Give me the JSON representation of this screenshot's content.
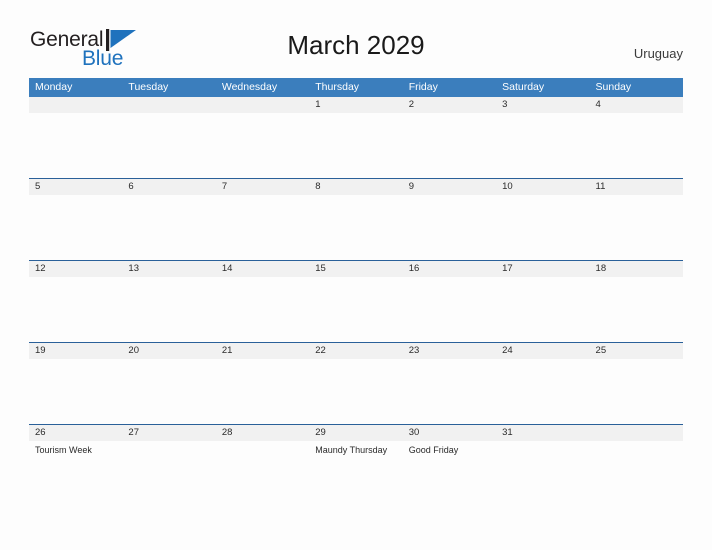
{
  "brand": {
    "name_part1": "General",
    "name_part2": "Blue",
    "logo_icon": "blue-flag-triangle-icon",
    "color_dark": "#231f20",
    "color_blue": "#1f72bd"
  },
  "header": {
    "title": "March 2029",
    "country": "Uruguay"
  },
  "theme": {
    "header_blue": "#3b7ebd",
    "separator_blue": "#2a6099",
    "date_band_gray": "#f1f1f1",
    "page_background": "#fdfdfd",
    "text_color": "#2b2b2b"
  },
  "calendar": {
    "weekdays": [
      "Monday",
      "Tuesday",
      "Wednesday",
      "Thursday",
      "Friday",
      "Saturday",
      "Sunday"
    ],
    "weeks": [
      {
        "days": [
          {
            "date": "",
            "events": []
          },
          {
            "date": "",
            "events": []
          },
          {
            "date": "",
            "events": []
          },
          {
            "date": "1",
            "events": []
          },
          {
            "date": "2",
            "events": []
          },
          {
            "date": "3",
            "events": []
          },
          {
            "date": "4",
            "events": []
          }
        ]
      },
      {
        "days": [
          {
            "date": "5",
            "events": []
          },
          {
            "date": "6",
            "events": []
          },
          {
            "date": "7",
            "events": []
          },
          {
            "date": "8",
            "events": []
          },
          {
            "date": "9",
            "events": []
          },
          {
            "date": "10",
            "events": []
          },
          {
            "date": "11",
            "events": []
          }
        ]
      },
      {
        "days": [
          {
            "date": "12",
            "events": []
          },
          {
            "date": "13",
            "events": []
          },
          {
            "date": "14",
            "events": []
          },
          {
            "date": "15",
            "events": []
          },
          {
            "date": "16",
            "events": []
          },
          {
            "date": "17",
            "events": []
          },
          {
            "date": "18",
            "events": []
          }
        ]
      },
      {
        "days": [
          {
            "date": "19",
            "events": []
          },
          {
            "date": "20",
            "events": []
          },
          {
            "date": "21",
            "events": []
          },
          {
            "date": "22",
            "events": []
          },
          {
            "date": "23",
            "events": []
          },
          {
            "date": "24",
            "events": []
          },
          {
            "date": "25",
            "events": []
          }
        ]
      },
      {
        "days": [
          {
            "date": "26",
            "events": [
              "Tourism Week"
            ]
          },
          {
            "date": "27",
            "events": []
          },
          {
            "date": "28",
            "events": []
          },
          {
            "date": "29",
            "events": [
              "Maundy Thursday"
            ]
          },
          {
            "date": "30",
            "events": [
              "Good Friday"
            ]
          },
          {
            "date": "31",
            "events": []
          },
          {
            "date": "",
            "events": []
          }
        ]
      }
    ]
  }
}
